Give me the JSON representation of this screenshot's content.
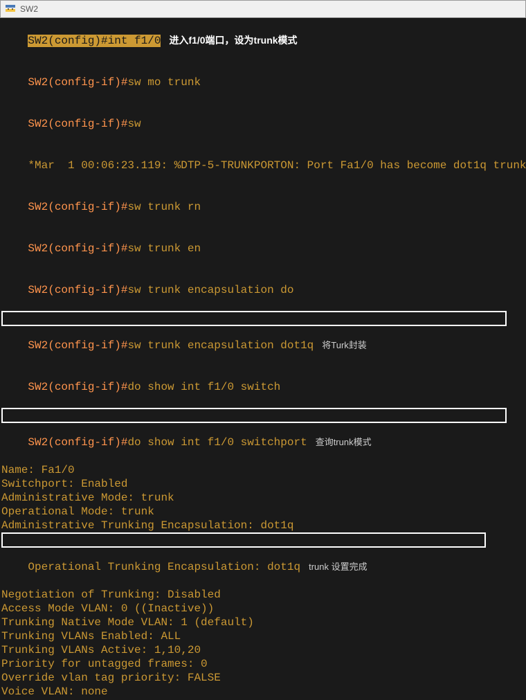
{
  "window": {
    "title": "SW2"
  },
  "lines": {
    "l0_prompt": "SW2(config)#",
    "l0_cmd": "int f1/0",
    "l0_note": "进入f1/0端口，设为trunk模式",
    "l1_prompt": "SW2(config-if)#",
    "l1_cmd": "sw mo trunk",
    "l2_prompt": "SW2(config-if)#",
    "l2_cmd": "sw",
    "l3": "*Mar  1 00:06:23.119: %DTP-5-TRUNKPORTON: Port Fa1/0 has become dot1q trunk",
    "l4_prompt": "SW2(config-if)#",
    "l4_cmd": "sw trunk rn",
    "l5_prompt": "SW2(config-if)#",
    "l5_cmd": "sw trunk en",
    "l6_prompt": "SW2(config-if)#",
    "l6_cmd": "sw trunk encapsulation do",
    "l7_prompt": "SW2(config-if)#",
    "l7_cmd": "sw trunk encapsulation dot1q",
    "l7_note": "将Turk封装",
    "l8_prompt": "SW2(config-if)#",
    "l8_cmd": "do show int f1/0 switch",
    "l9_prompt": "SW2(config-if)#",
    "l9_cmd": "do show int f1/0 switchport",
    "l9_note": "查询trunk模式",
    "out_name": "Name: Fa1/0",
    "out_sp": "Switchport: Enabled",
    "out_am": "Administrative Mode: trunk",
    "out_om": "Operational Mode: trunk",
    "out_ate": "Administrative Trunking Encapsulation: dot1q",
    "out_ote": "Operational Trunking Encapsulation: dot1q",
    "out_ote_note": "trunk 设置完成",
    "out_neg": "Negotiation of Trunking: Disabled",
    "out_amv": "Access Mode VLAN: 0 ((Inactive))",
    "out_tnm": "Trunking Native Mode VLAN: 1 (default)",
    "out_tve": "Trunking VLANs Enabled: ALL",
    "out_tva": "Trunking VLANs Active: 1,10,20",
    "out_puf": "Priority for untagged frames: 0",
    "out_ovtp": "Override vlan tag priority: FALSE",
    "out_vv": "Voice VLAN: none"
  }
}
